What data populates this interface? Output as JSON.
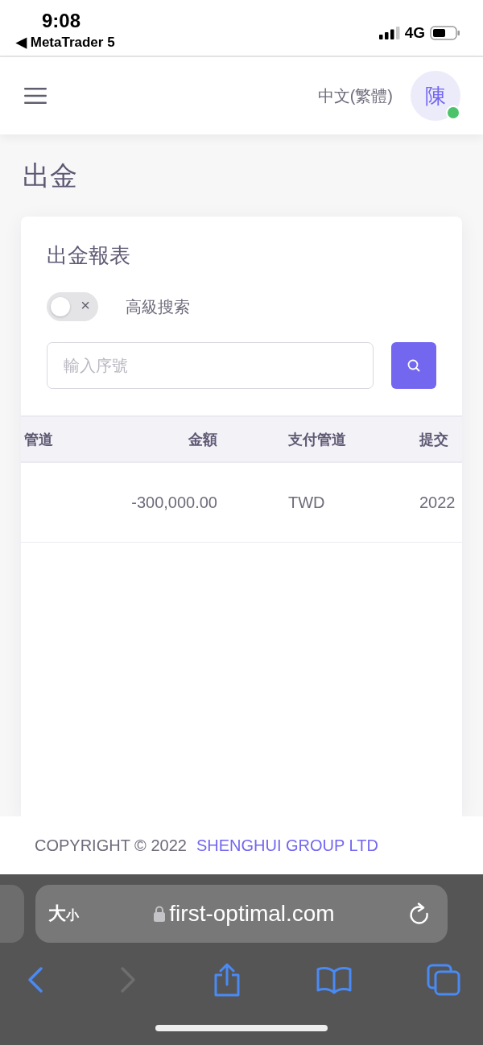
{
  "status_bar": {
    "time": "9:08",
    "back_app": "◀ MetaTrader 5",
    "network": "4G"
  },
  "header": {
    "language": "中文(繁體)",
    "avatar": "陳",
    "online": true
  },
  "page_title": "出金",
  "card": {
    "title": "出金報表",
    "advanced_search": {
      "label": "高級搜索",
      "on": false,
      "toggle_mark": "×"
    },
    "search": {
      "placeholder": "輸入序號"
    }
  },
  "table": {
    "columns": [
      "管道",
      "金額",
      "支付管道",
      "提交"
    ],
    "rows": [
      {
        "amount": "-300,000.00",
        "payment_channel": "TWD",
        "submitted": "2022"
      }
    ]
  },
  "footer": {
    "copyright": "COPYRIGHT © 2022",
    "company": "SHENGHUI GROUP LTD"
  },
  "browser": {
    "text_size_large": "大",
    "text_size_small": "小",
    "url": "first-optimal.com",
    "back_enabled": true,
    "forward_enabled": false
  }
}
